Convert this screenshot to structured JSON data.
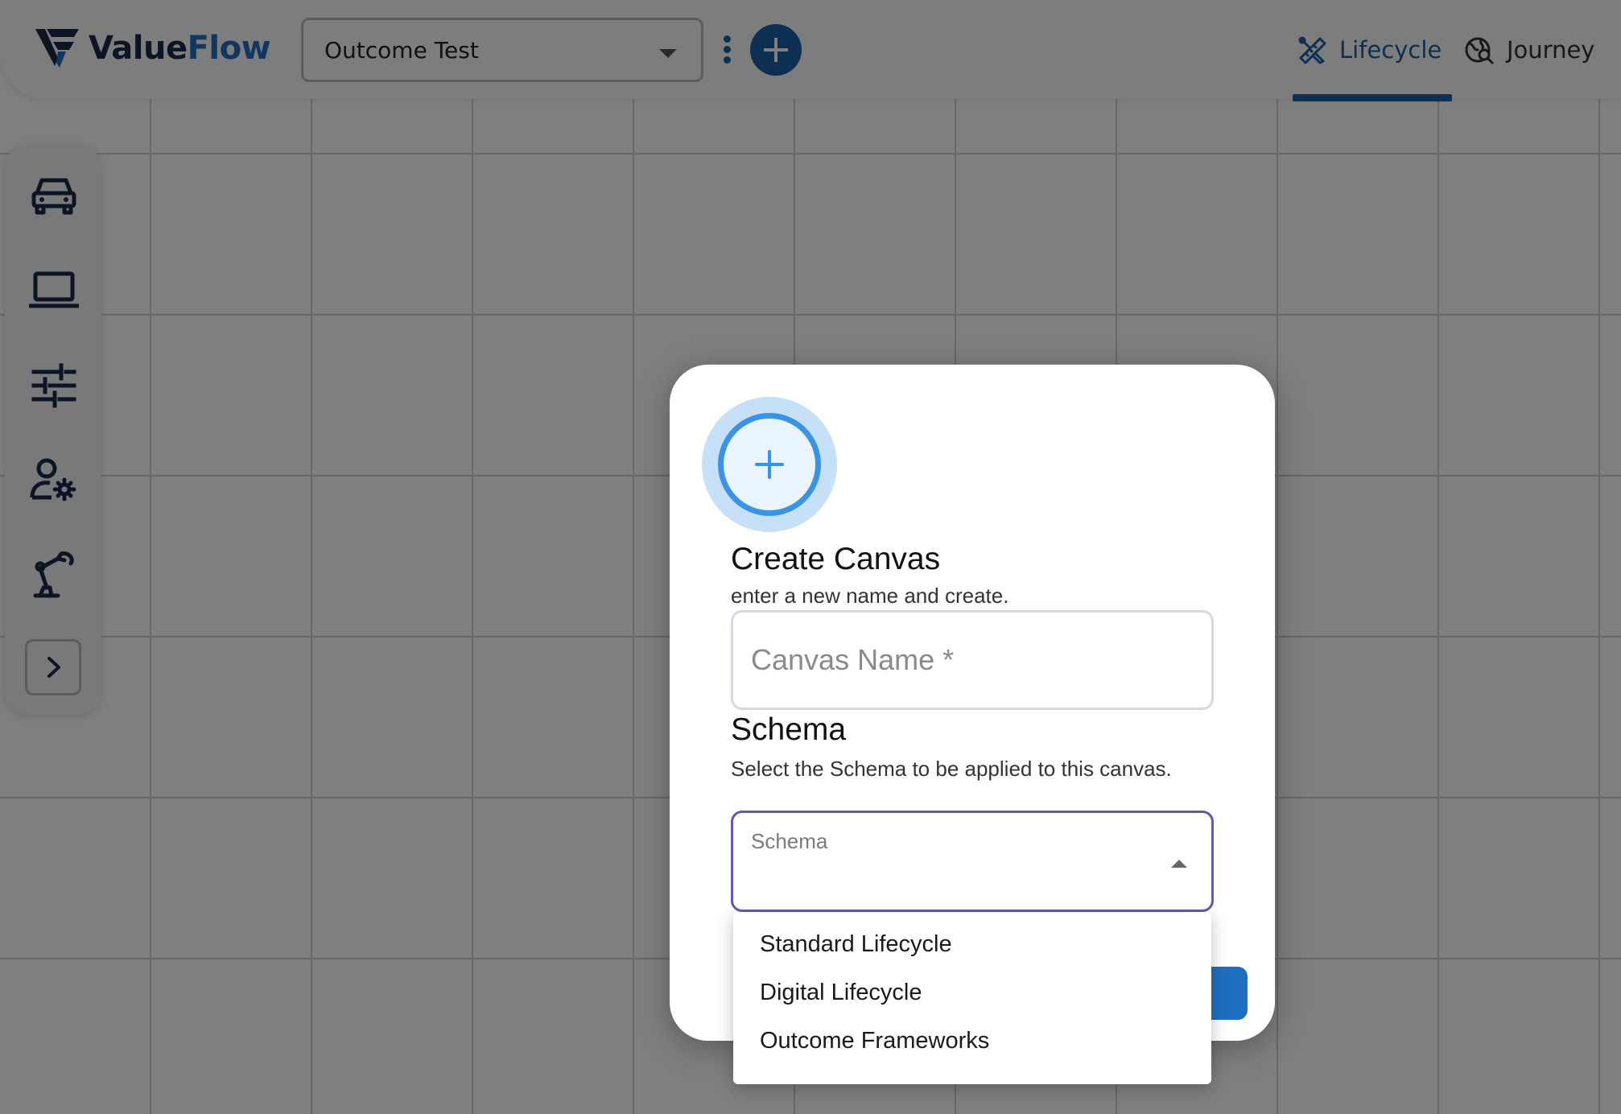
{
  "header": {
    "logo": {
      "part1": "Value",
      "part2": "Flow"
    },
    "canvas_select": {
      "value": "Outcome Test"
    },
    "more_icon": "kebab-vertical-icon",
    "add_icon": "plus-icon",
    "tabs": [
      {
        "label": "Lifecycle",
        "icon": "tools-icon",
        "active": true
      },
      {
        "label": "Journey",
        "icon": "globe-search-icon",
        "active": false
      }
    ]
  },
  "sidebar": {
    "items": [
      {
        "icon": "car-icon"
      },
      {
        "icon": "laptop-icon"
      },
      {
        "icon": "sliders-icon"
      },
      {
        "icon": "user-settings-icon"
      },
      {
        "icon": "robot-arm-icon"
      }
    ],
    "expand_icon": "chevron-right-icon"
  },
  "modal": {
    "icon": "plus-icon",
    "title": "Create Canvas",
    "subtitle": "enter a new name and create.",
    "name_placeholder": "Canvas Name *",
    "schema_title": "Schema",
    "schema_description": "Select the Schema to be applied to this canvas.",
    "schema_label": "Schema"
  },
  "dropdown": {
    "options": [
      "Standard Lifecycle",
      "Digital Lifecycle",
      "Outcome Frameworks"
    ]
  },
  "colors": {
    "primary": "#1b5fa5",
    "accent": "#1f6fc0",
    "focus_border": "#6a55b0",
    "overlay": "rgba(0,0,0,0.5)"
  }
}
